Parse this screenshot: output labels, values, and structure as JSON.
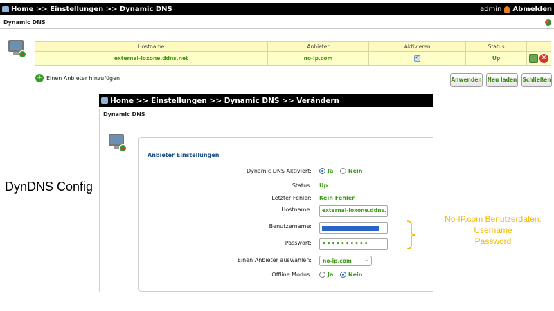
{
  "window": {
    "breadcrumb": "Home >> Einstellungen >> Dynamic DNS",
    "user": "admin",
    "logout": "Abmelden",
    "section_title": "Dynamic DNS"
  },
  "table": {
    "headers": [
      "Hostname",
      "Anbieter",
      "Aktivieren",
      "Status"
    ],
    "rows": [
      {
        "hostname": "external-loxone.ddns.net",
        "provider": "no-ip.com",
        "enabled": true,
        "status": "Up"
      }
    ]
  },
  "actions": {
    "add_provider": "Einen Anbieter hinzufügen",
    "apply": "Anwenden",
    "reload": "Neu laden",
    "close": "Schließen"
  },
  "side_label": "DynDNS Config",
  "dialog": {
    "breadcrumb": "Home >> Einstellungen >> Dynamic DNS >> Verändern",
    "section_title": "Dynamic DNS",
    "legend": "Anbieter Einstellungen",
    "fields": {
      "dyndns_active": {
        "label": "Dynamic DNS Aktiviert:",
        "options": [
          "Ja",
          "Nein"
        ],
        "selected": "Ja"
      },
      "status": {
        "label": "Status:",
        "value": "Up"
      },
      "last_error": {
        "label": "Letzter Fehler:",
        "value": "Kein Fehler"
      },
      "hostname": {
        "label": "Hostname:",
        "value": "external-loxone.ddns."
      },
      "username": {
        "label": "Benutzername:"
      },
      "password": {
        "label": "Passwort:",
        "value": "••••••••••"
      },
      "provider": {
        "label": "Einen Anbieter auswählen:",
        "value": "no-ip.com"
      },
      "offline": {
        "label": "Offline Modus:",
        "options": [
          "Ja",
          "Nein"
        ],
        "selected": "Nein"
      }
    }
  },
  "annotation": {
    "line1": "No-IP.com Benutzerdaten:",
    "line2": "Username",
    "line3": "Password",
    "color": "#f5b800"
  }
}
